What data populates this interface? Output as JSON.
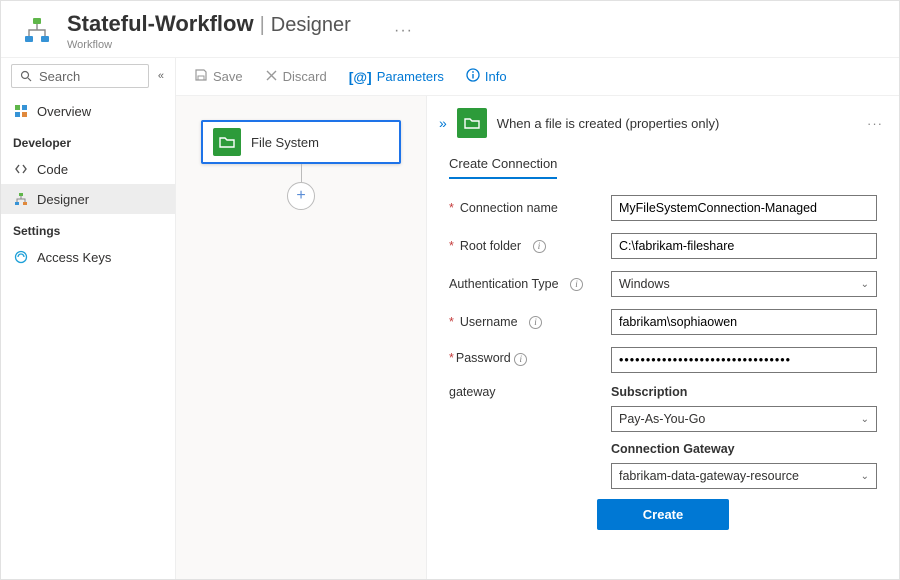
{
  "header": {
    "title": "Stateful-Workflow",
    "section": "Designer",
    "subtitle": "Workflow"
  },
  "sidebar": {
    "search_placeholder": "Search",
    "overview": "Overview",
    "heading_developer": "Developer",
    "code": "Code",
    "designer": "Designer",
    "heading_settings": "Settings",
    "access_keys": "Access Keys"
  },
  "toolbar": {
    "save": "Save",
    "discard": "Discard",
    "parameters": "Parameters",
    "info": "Info"
  },
  "canvas": {
    "node_label": "File System"
  },
  "panel": {
    "title": "When a file is created (properties only)",
    "tab": "Create Connection",
    "labels": {
      "connection_name": "Connection name",
      "root_folder": "Root folder",
      "auth_type": "Authentication Type",
      "username": "Username",
      "password": "Password",
      "gateway": "gateway",
      "subscription": "Subscription",
      "connection_gateway": "Connection Gateway"
    },
    "values": {
      "connection_name": "MyFileSystemConnection-Managed",
      "root_folder": "C:\\fabrikam-fileshare",
      "auth_type": "Windows",
      "username": "fabrikam\\sophiaowen",
      "password": "••••••••••••••••••••••••••••••••",
      "subscription": "Pay-As-You-Go",
      "connection_gateway": "fabrikam-data-gateway-resource"
    },
    "create_button": "Create"
  }
}
